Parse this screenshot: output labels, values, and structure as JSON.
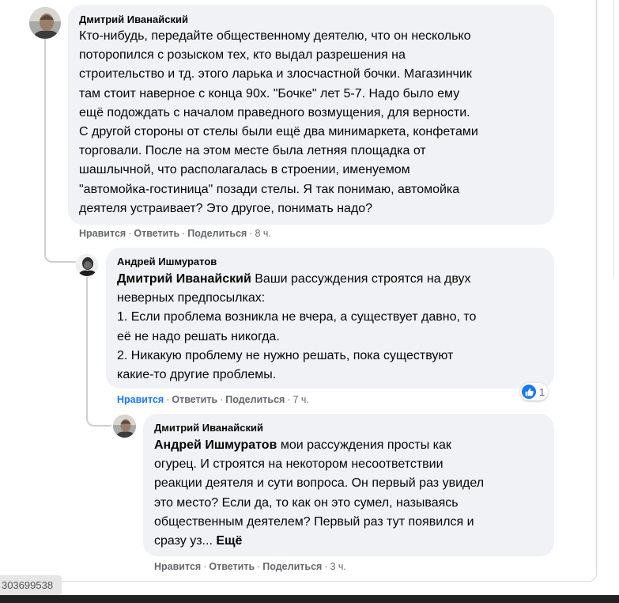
{
  "comments": [
    {
      "author": "Дмитрий Иванайский",
      "lines": [
        "Кто-нибудь, передайте общественному деятелю, что он несколько",
        "поторопился с розыском тех, кто выдал разрешения на",
        "строительство и тд. этого ларька и злосчастной бочки. Магазинчик",
        "там стоит наверное с конца 90х. \"Бочке\" лет 5-7. Надо было ему",
        "ещё подождать с началом праведного возмущения, для верности.",
        "С другой стороны от стелы были ещё два минимаркета, конфетами",
        "торговали. После на этом месте была летняя площадка от",
        "шашлычной, что располагалась в строении, именуемом",
        "\"автомойка-гостиница\" позади стелы. Я так понимаю, автомойка",
        "деятеля устраивает? Это другое, понимать надо?"
      ],
      "actions": {
        "like": "Нравится",
        "reply": "Ответить",
        "share": "Поделиться",
        "time": "8 ч."
      }
    },
    {
      "author": "Андрей Ишмуратов",
      "mention": "Дмитрий Иванайский",
      "first_line_rest": " Ваши рассуждения строятся на двух",
      "lines": [
        "неверных предпосылках:",
        "1. Если проблема возникла не вчера, а существует давно, то",
        "её не надо решать никогда.",
        "2. Никакую проблему не нужно решать, пока существуют",
        "какие-то другие проблемы."
      ],
      "actions": {
        "like": "Нравится",
        "reply": "Ответить",
        "share": "Поделиться",
        "time": "7 ч."
      },
      "reaction_count": "1"
    },
    {
      "author": "Дмитрий Иванайский",
      "mention": "Андрей Ишмуратов",
      "first_line_rest": " мои рассуждения просты как",
      "lines": [
        "огурец. И строятся на некотором несоответствии",
        "реакции деятеля и сути вопроса. Он первый раз увидел",
        "это место? Если да, то как он это сумел, называясь",
        "общественным деятелем? Первый раз тут появился и"
      ],
      "last_line": "сразу уз... ",
      "see_more": "Ещё",
      "actions": {
        "like": "Нравится",
        "reply": "Ответить",
        "share": "Поделиться",
        "time": "3 ч."
      }
    }
  ],
  "footer_id": "303699538",
  "colors": {
    "bubble": "#f0f2f5",
    "meta": "#65676b",
    "link_blue": "#1877f2"
  }
}
